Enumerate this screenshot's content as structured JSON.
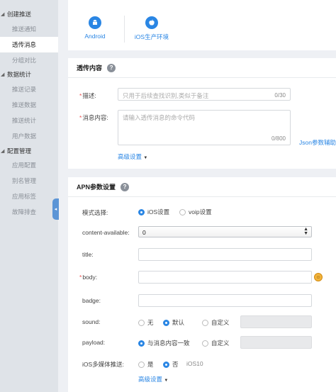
{
  "sidebar": {
    "groups": [
      {
        "label": "创建推送",
        "items": [
          "推送通知",
          "透传消息",
          "分组对比"
        ]
      },
      {
        "label": "数据统计",
        "items": [
          "推送记录",
          "推送数据",
          "推送统计",
          "用户数据"
        ]
      },
      {
        "label": "配置管理",
        "items": [
          "应用配置",
          "别名管理",
          "应用标签",
          "故障排查"
        ]
      }
    ],
    "active_item": "透传消息"
  },
  "platforms": [
    {
      "label": "Android",
      "icon": "android-icon"
    },
    {
      "label": "iOS生产环境",
      "icon": "apple-icon"
    }
  ],
  "passthrough": {
    "title": "透传内容",
    "desc_label": "描述",
    "desc_placeholder": "只用于后续查找识别,类似于备注",
    "desc_counter": "0/30",
    "content_label": "消息内容",
    "content_placeholder": "请输入透传消息的命令代码",
    "content_counter": "0/800",
    "json_link": "Json参数辅助",
    "advanced": "高级设置"
  },
  "apn": {
    "title": "APN参数设置",
    "mode_label": "模式选择",
    "mode_options": [
      "iOS设置",
      "voip设置"
    ],
    "content_available_label": "content-available",
    "content_available_value": "0",
    "title_label": "title",
    "body_label": "body",
    "badge_label": "badge",
    "sound_label": "sound",
    "sound_options": [
      "无",
      "默认",
      "自定义"
    ],
    "payload_label": "payload",
    "payload_options": [
      "与消息内容一致",
      "自定义"
    ],
    "multimedia_label": "iOS多媒体推送",
    "multimedia_options": [
      "是",
      "否"
    ],
    "multimedia_note": "iOS10",
    "advanced": "高级设置"
  },
  "colors": {
    "accent": "#2a86e4",
    "sidebar_bg": "#dfe3e8",
    "required": "#e55555"
  }
}
